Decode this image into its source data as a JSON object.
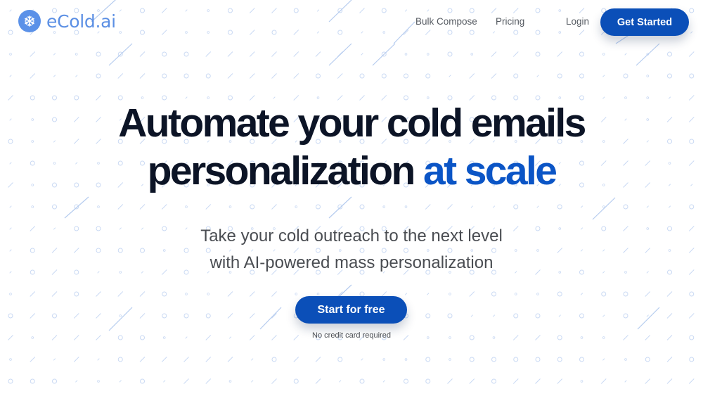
{
  "brand": {
    "name": "eCold.ai",
    "logo_icon": "snowflake-icon",
    "logo_color": "#5b91e8"
  },
  "nav": {
    "links": [
      {
        "label": "Bulk Compose"
      },
      {
        "label": "Pricing"
      }
    ],
    "login_label": "Login",
    "cta_label": "Get Started"
  },
  "hero": {
    "headline_line1": "Automate your cold emails",
    "headline_line2_plain": "personalization",
    "headline_line2_accent": "at scale",
    "subhead_line1": "Take your cold outreach to the next level",
    "subhead_line2": "with AI-powered mass personalization",
    "cta_label": "Start for free",
    "cta_note": "No credit card required"
  },
  "colors": {
    "primary": "#0b4fb8",
    "accent_text": "#0b55c6",
    "headline": "#0c1426",
    "body_text": "#4a4d52",
    "pattern": "#c9d9f3"
  }
}
